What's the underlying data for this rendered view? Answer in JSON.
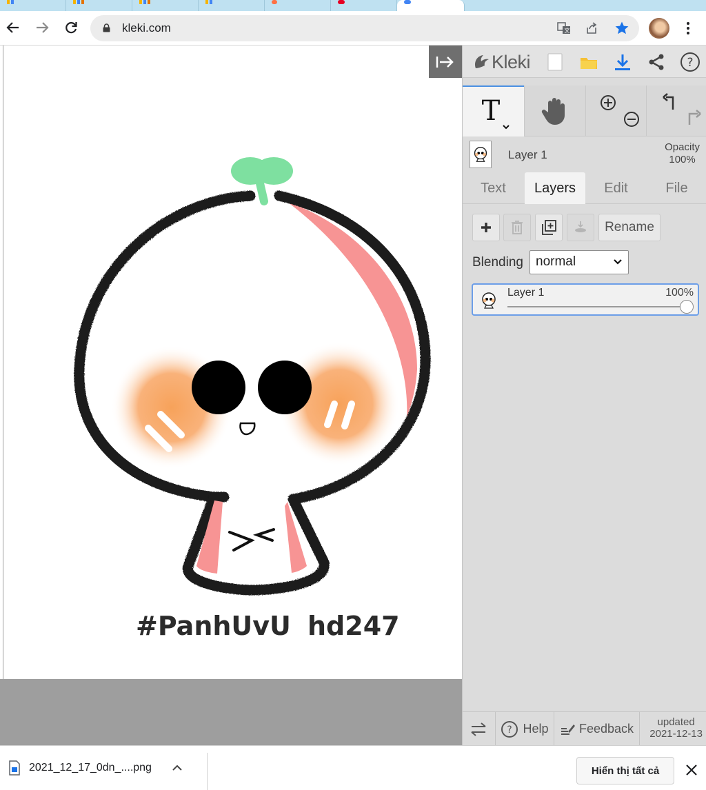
{
  "browser": {
    "url": "kleki.com"
  },
  "app": {
    "name": "Kleki",
    "current_layer": "Layer 1",
    "opacity_label": "Opacity",
    "opacity_value": "100%",
    "tabs": [
      "Text",
      "Layers",
      "Edit",
      "File"
    ],
    "selected_tab": "Layers",
    "rename_label": "Rename",
    "blending_label": "Blending",
    "blending_value": "normal",
    "layers": [
      {
        "name": "Layer 1",
        "opacity": "100%",
        "opacity_fraction": 1.0
      }
    ],
    "footer": {
      "help": "Help",
      "feedback": "Feedback",
      "updated_label": "updated",
      "updated_date": "2021-12-13"
    }
  },
  "canvas": {
    "caption_left": "#PanhUvU",
    "caption_right": "hd247",
    "mouth_text": "><"
  },
  "downloads": {
    "file_name": "2021_12_17_0dn_....png",
    "show_all": "Hiển thị tất cả"
  },
  "colors": {
    "accent": "#4a90e2",
    "sprout": "#7ee0a0",
    "blush": "#f7a25a",
    "cheek_pink": "#f79494"
  }
}
